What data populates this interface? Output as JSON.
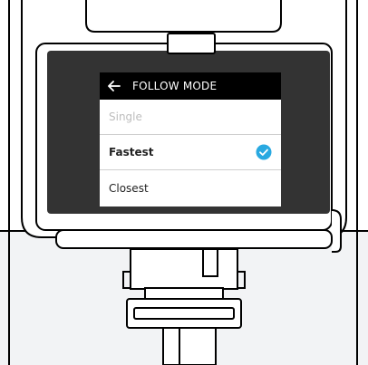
{
  "screen": {
    "header": {
      "title": "FOLLOW MODE",
      "back_icon": "left-arrow-icon"
    },
    "options": [
      {
        "label": "Single",
        "state": "disabled"
      },
      {
        "label": "Fastest",
        "state": "selected"
      },
      {
        "label": "Closest",
        "state": "normal"
      }
    ],
    "selected_check_icon": "check-circle-icon"
  },
  "colors": {
    "device_dark": "#333333",
    "screen_header_bg": "#000000",
    "accent_check": "#29a9e1",
    "outline": "#000000",
    "enclosure_gray": "#f2f3f5",
    "divider": "#cfcfcf",
    "disabled_text": "#bdbdbd"
  }
}
